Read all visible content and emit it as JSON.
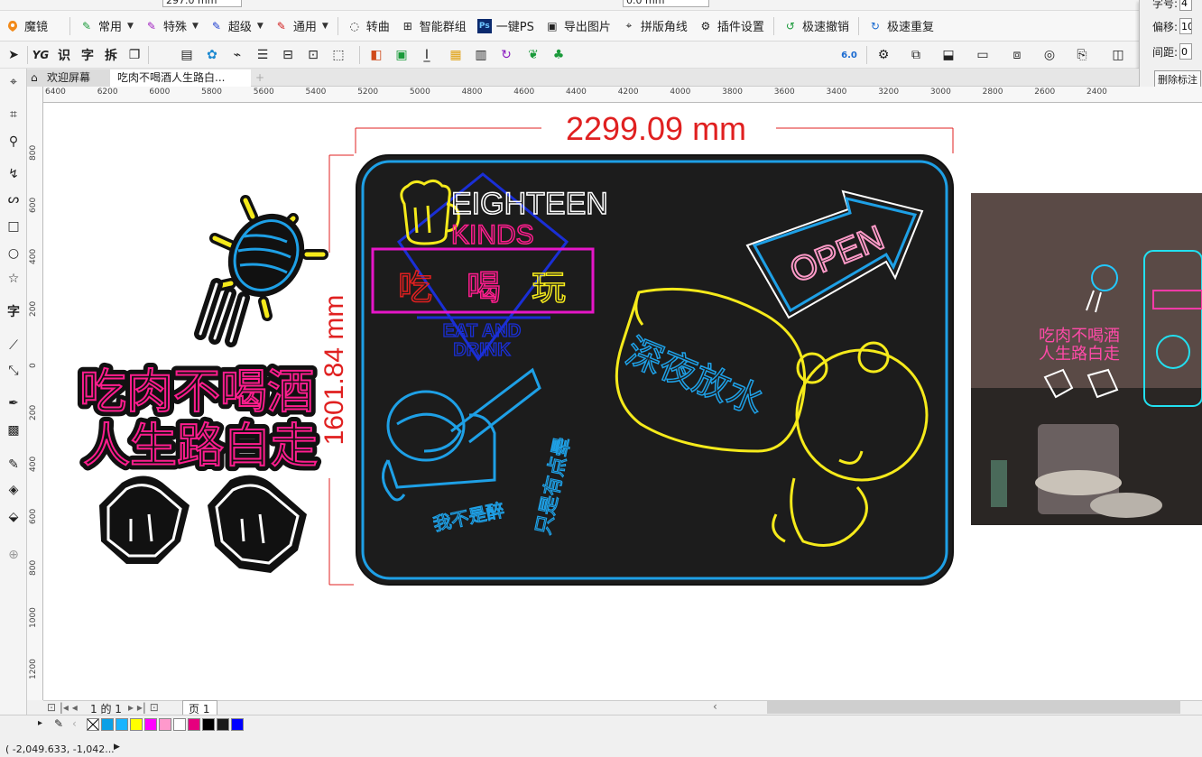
{
  "topstrip": {
    "size_field": "297.0 mm",
    "offset_field": "0.0 mm"
  },
  "menubar": {
    "items": [
      {
        "label": "魔镜",
        "icon": "mirror-icon",
        "dropdown": false
      },
      {
        "label": "常用",
        "icon": "brush-icon",
        "dropdown": true
      },
      {
        "label": "特殊",
        "icon": "brush-icon",
        "dropdown": true
      },
      {
        "label": "超级",
        "icon": "brush-icon",
        "dropdown": true
      },
      {
        "label": "通用",
        "icon": "brush-icon",
        "dropdown": true
      },
      {
        "label": "转曲",
        "icon": "curve-icon",
        "dropdown": false
      },
      {
        "label": "智能群组",
        "icon": "group-icon",
        "dropdown": false
      },
      {
        "label": "一键PS",
        "icon": "ps-icon",
        "dropdown": false
      },
      {
        "label": "导出图片",
        "icon": "image-icon",
        "dropdown": false
      },
      {
        "label": "拼版角线",
        "icon": "crop-marks-icon",
        "dropdown": false
      },
      {
        "label": "插件设置",
        "icon": "gear-icon",
        "dropdown": false
      },
      {
        "label": "极速撤销",
        "icon": "undo-icon",
        "dropdown": false
      },
      {
        "label": "极速重复",
        "icon": "redo-icon",
        "dropdown": false
      }
    ]
  },
  "toolbar2": {
    "text_buttons": [
      "识",
      "字",
      "拆"
    ],
    "cut_version": "6.0"
  },
  "rpanel": {
    "font_size_label": "字号:",
    "font_size_value": "4",
    "offset_label": "偏移:",
    "offset_value": "10",
    "spacing_label": "间距:",
    "spacing_value": "0",
    "delete_button": "删除标注"
  },
  "tabs": [
    {
      "label": "欢迎屏幕",
      "icon": "home-icon"
    },
    {
      "label": "吃肉不喝酒人生路白...",
      "icon": ""
    }
  ],
  "ruler": {
    "h_ticks": [
      "6400",
      "6200",
      "6000",
      "5800",
      "5600",
      "5400",
      "5200",
      "5000",
      "4800",
      "4600",
      "4400",
      "4200",
      "4000",
      "3800",
      "3600",
      "3400",
      "3200",
      "3000",
      "2800",
      "2600",
      "2400"
    ],
    "v_ticks": [
      "800",
      "600",
      "400",
      "200",
      "0",
      "200",
      "400",
      "600",
      "800",
      "1000",
      "1200"
    ]
  },
  "canvas": {
    "dim_width": "2299.09 mm",
    "dim_height": "1601.84 mm",
    "sign": {
      "title_line1": "EIGHTEEN",
      "title_line2": "KINDS",
      "chars": [
        "吃",
        "喝",
        "玩"
      ],
      "eat_drink_line1": "EAT AND",
      "eat_drink_line2": "DRINK",
      "open": "OPEN",
      "bowl_text": "深夜放水",
      "banner1": "我不是醉",
      "banner2": "只是有点晕"
    },
    "slogan_line1": "吃肉不喝酒",
    "slogan_line2": "人生路白走",
    "colors": {
      "cyan": "#1ea0e6",
      "pink": "#ff1d8e",
      "yellow": "#f5ea1b",
      "magenta": "#e616c8",
      "blue": "#1a2fd6",
      "dim_red": "#e02020"
    }
  },
  "pagebar": {
    "page_of": "1 的 1",
    "page_tab": "页 1"
  },
  "palette": {
    "colors": [
      "#0aa0e6",
      "#18b4ff",
      "#ffff00",
      "#ff00ff",
      "#ff99cc",
      "#ffffff",
      "#e6007e",
      "#000000",
      "#1a1a1a",
      "#0000ff"
    ]
  },
  "status": {
    "coords": "( -2,049.633, -1,042..."
  }
}
